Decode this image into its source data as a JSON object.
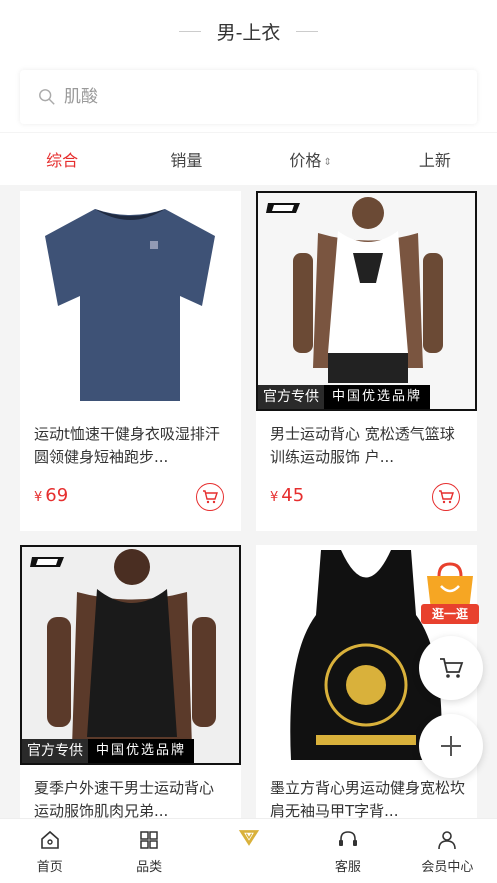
{
  "header": {
    "title": "男-上衣"
  },
  "search": {
    "placeholder": "肌酸"
  },
  "tabs": [
    {
      "label": "综合",
      "active": true
    },
    {
      "label": "销量"
    },
    {
      "label": "价格"
    },
    {
      "label": "上新"
    }
  ],
  "products": [
    {
      "name": "运动t恤速干健身衣吸湿排汗圆领健身短袖跑步...",
      "currency": "¥",
      "price": "69"
    },
    {
      "name": "男士运动背心 宽松透气篮球训练运动服饰 户...",
      "currency": "¥",
      "price": "45",
      "badge_left": "官方专供",
      "badge_right": "中国优选品牌"
    },
    {
      "name": "夏季户外速干男士运动背心 运动服饰肌肉兄弟...",
      "badge_left": "官方专供",
      "badge_right": "中国优选品牌"
    },
    {
      "name": "墨立方背心男运动健身宽松坎肩无袖马甲T字背..."
    }
  ],
  "promo": {
    "label": "逛一逛"
  },
  "nav": [
    {
      "label": "首页",
      "icon": "home-icon"
    },
    {
      "label": "品类",
      "icon": "grid-icon"
    },
    {
      "label": "",
      "icon": "brand-logo"
    },
    {
      "label": "客服",
      "icon": "headset-icon"
    },
    {
      "label": "会员中心",
      "icon": "user-icon"
    }
  ],
  "colors": {
    "accent": "#e62e2e",
    "background": "#f4f4f4"
  }
}
